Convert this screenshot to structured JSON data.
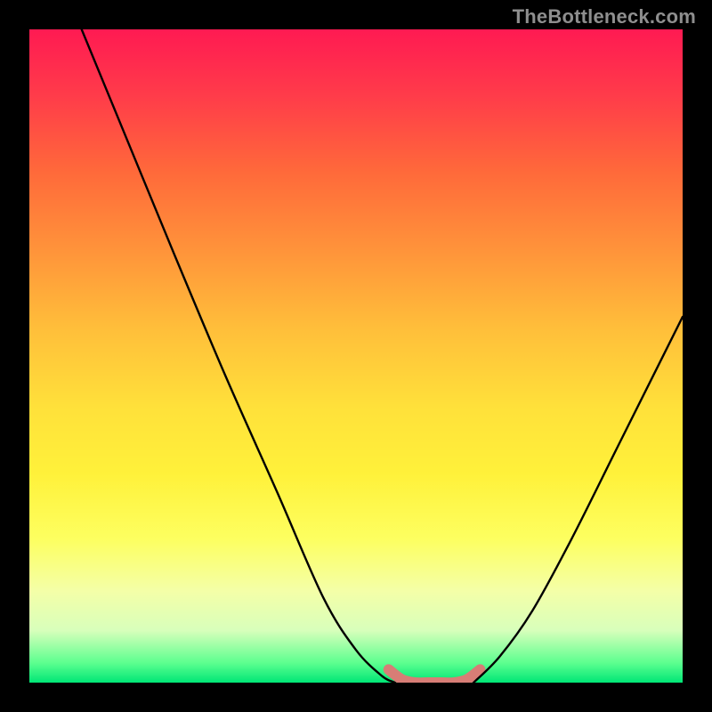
{
  "watermark": "TheBottleneck.com",
  "chart_data": {
    "type": "line",
    "title": "",
    "xlabel": "",
    "ylabel": "",
    "xlim": [
      0,
      100
    ],
    "ylim": [
      0,
      100
    ],
    "grid": false,
    "legend": false,
    "series": [
      {
        "name": "left-curve",
        "color": "#000000",
        "x": [
          8,
          15,
          22,
          30,
          38,
          45,
          50,
          54,
          56
        ],
        "y": [
          100,
          83,
          66,
          47,
          29,
          13,
          5,
          1,
          0
        ]
      },
      {
        "name": "floor",
        "color": "#d77d76",
        "x": [
          55,
          57,
          59,
          61,
          63,
          65,
          67,
          69
        ],
        "y": [
          2,
          0.5,
          0,
          0,
          0,
          0,
          0.5,
          2
        ]
      },
      {
        "name": "right-curve",
        "color": "#000000",
        "x": [
          68,
          72,
          77,
          83,
          90,
          96,
          100
        ],
        "y": [
          0,
          4,
          11,
          22,
          36,
          48,
          56
        ]
      }
    ]
  }
}
